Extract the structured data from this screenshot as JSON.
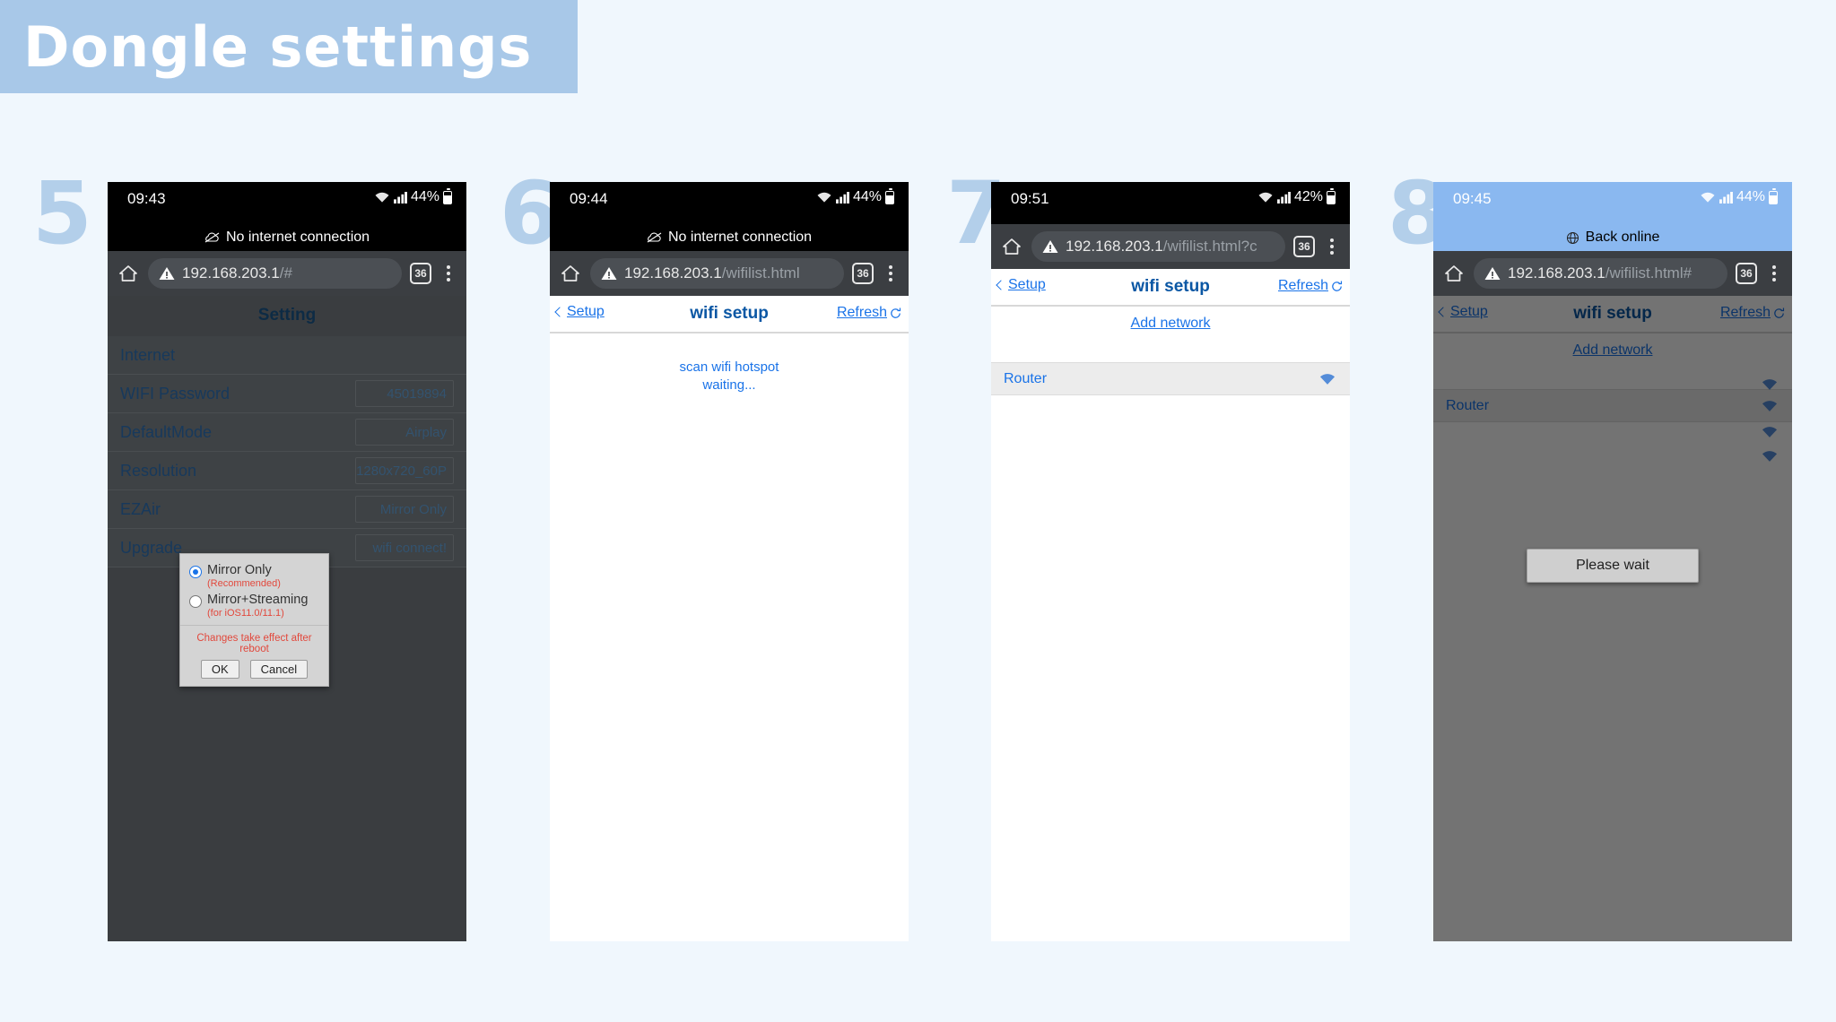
{
  "header": {
    "title": "Dongle settings",
    "band_color": "#a8c8e8",
    "text_color": "#ffffff"
  },
  "page_background": "#f0f7fd",
  "steps": [
    {
      "number": "5",
      "status_bar": {
        "time": "09:43",
        "battery": "44%",
        "wifi_icon": "wifi-icon",
        "signal_icon": "signal-bars-icon",
        "battery_icon": "battery-icon",
        "online": false
      },
      "net_banner": {
        "text": "No internet connection",
        "icon": "cloud-off-icon",
        "online": false
      },
      "toolbar": {
        "home_icon": "home-icon",
        "warning_icon": "warning-triangle-icon",
        "url_main": "192.168.203.1",
        "url_dim": "/#",
        "tab_count": "36",
        "menu_icon": "overflow-menu-icon"
      },
      "page": {
        "kind": "settings",
        "title": "Setting",
        "rows": [
          {
            "label": "Internet",
            "value": ""
          },
          {
            "label": "WIFI Password",
            "value": "45019894"
          },
          {
            "label": "DefaultMode",
            "value": "Airplay"
          },
          {
            "label": "Resolution",
            "value": "1280x720_60P"
          },
          {
            "label": "EZAir",
            "value": "Mirror Only"
          },
          {
            "label": "Upgrade",
            "value": "wifi connect!"
          }
        ],
        "dialog": {
          "options": [
            {
              "label": "Mirror Only",
              "note": "(Recommended)",
              "selected": true
            },
            {
              "label": "Mirror+Streaming",
              "note": "(for iOS11.0/11.1)",
              "selected": false
            }
          ],
          "note": "Changes take effect after reboot",
          "ok_label": "OK",
          "cancel_label": "Cancel"
        }
      }
    },
    {
      "number": "6",
      "status_bar": {
        "time": "09:44",
        "battery": "44%",
        "wifi_icon": "wifi-icon",
        "signal_icon": "signal-bars-icon",
        "battery_icon": "battery-icon",
        "online": false
      },
      "net_banner": {
        "text": "No internet connection",
        "icon": "cloud-off-icon",
        "online": false
      },
      "toolbar": {
        "home_icon": "home-icon",
        "warning_icon": "warning-triangle-icon",
        "url_main": "192.168.203.1",
        "url_dim": "/wifilist.html",
        "tab_count": "36",
        "menu_icon": "overflow-menu-icon"
      },
      "page": {
        "kind": "wifi",
        "back_label": "Setup",
        "title": "wifi setup",
        "refresh_label": "Refresh",
        "refresh_icon": "refresh-icon",
        "scan_line1": "scan wifi hotspot",
        "scan_line2": "waiting...",
        "add_network_label": "",
        "networks": []
      }
    },
    {
      "number": "7",
      "status_bar": {
        "time": "09:51",
        "battery": "42%",
        "wifi_icon": "wifi-icon",
        "signal_icon": "signal-bars-icon",
        "battery_icon": "battery-icon",
        "online": false
      },
      "net_banner": null,
      "toolbar": {
        "home_icon": "home-icon",
        "warning_icon": "warning-triangle-icon",
        "url_main": "192.168.203.1",
        "url_dim": "/wifilist.html?c",
        "tab_count": "36",
        "menu_icon": "overflow-menu-icon"
      },
      "page": {
        "kind": "wifi",
        "back_label": "Setup",
        "title": "wifi setup",
        "refresh_label": "Refresh",
        "refresh_icon": "refresh-icon",
        "scan_line1": "",
        "scan_line2": "",
        "add_network_label": "Add network",
        "networks": [
          {
            "ssid": "Router",
            "signal_icon": "wifi-signal-icon"
          }
        ]
      }
    },
    {
      "number": "8",
      "status_bar": {
        "time": "09:45",
        "battery": "44%",
        "wifi_icon": "wifi-icon",
        "signal_icon": "signal-bars-icon",
        "battery_icon": "battery-icon",
        "online": true
      },
      "net_banner": {
        "text": "Back online",
        "icon": "globe-icon",
        "online": true
      },
      "toolbar": {
        "home_icon": "home-icon",
        "warning_icon": "warning-triangle-icon",
        "url_main": "192.168.203.1",
        "url_dim": "/wifilist.html#",
        "tab_count": "36",
        "menu_icon": "overflow-menu-icon"
      },
      "page": {
        "kind": "wifi",
        "back_label": "Setup",
        "title": "wifi setup",
        "refresh_label": "Refresh",
        "refresh_icon": "refresh-icon",
        "scan_line1": "",
        "scan_line2": "",
        "add_network_label": "Add network",
        "networks": [
          {
            "ssid": "Router",
            "signal_icon": "wifi-signal-icon"
          }
        ],
        "wait_dialog": {
          "text": "Please wait"
        }
      }
    }
  ]
}
